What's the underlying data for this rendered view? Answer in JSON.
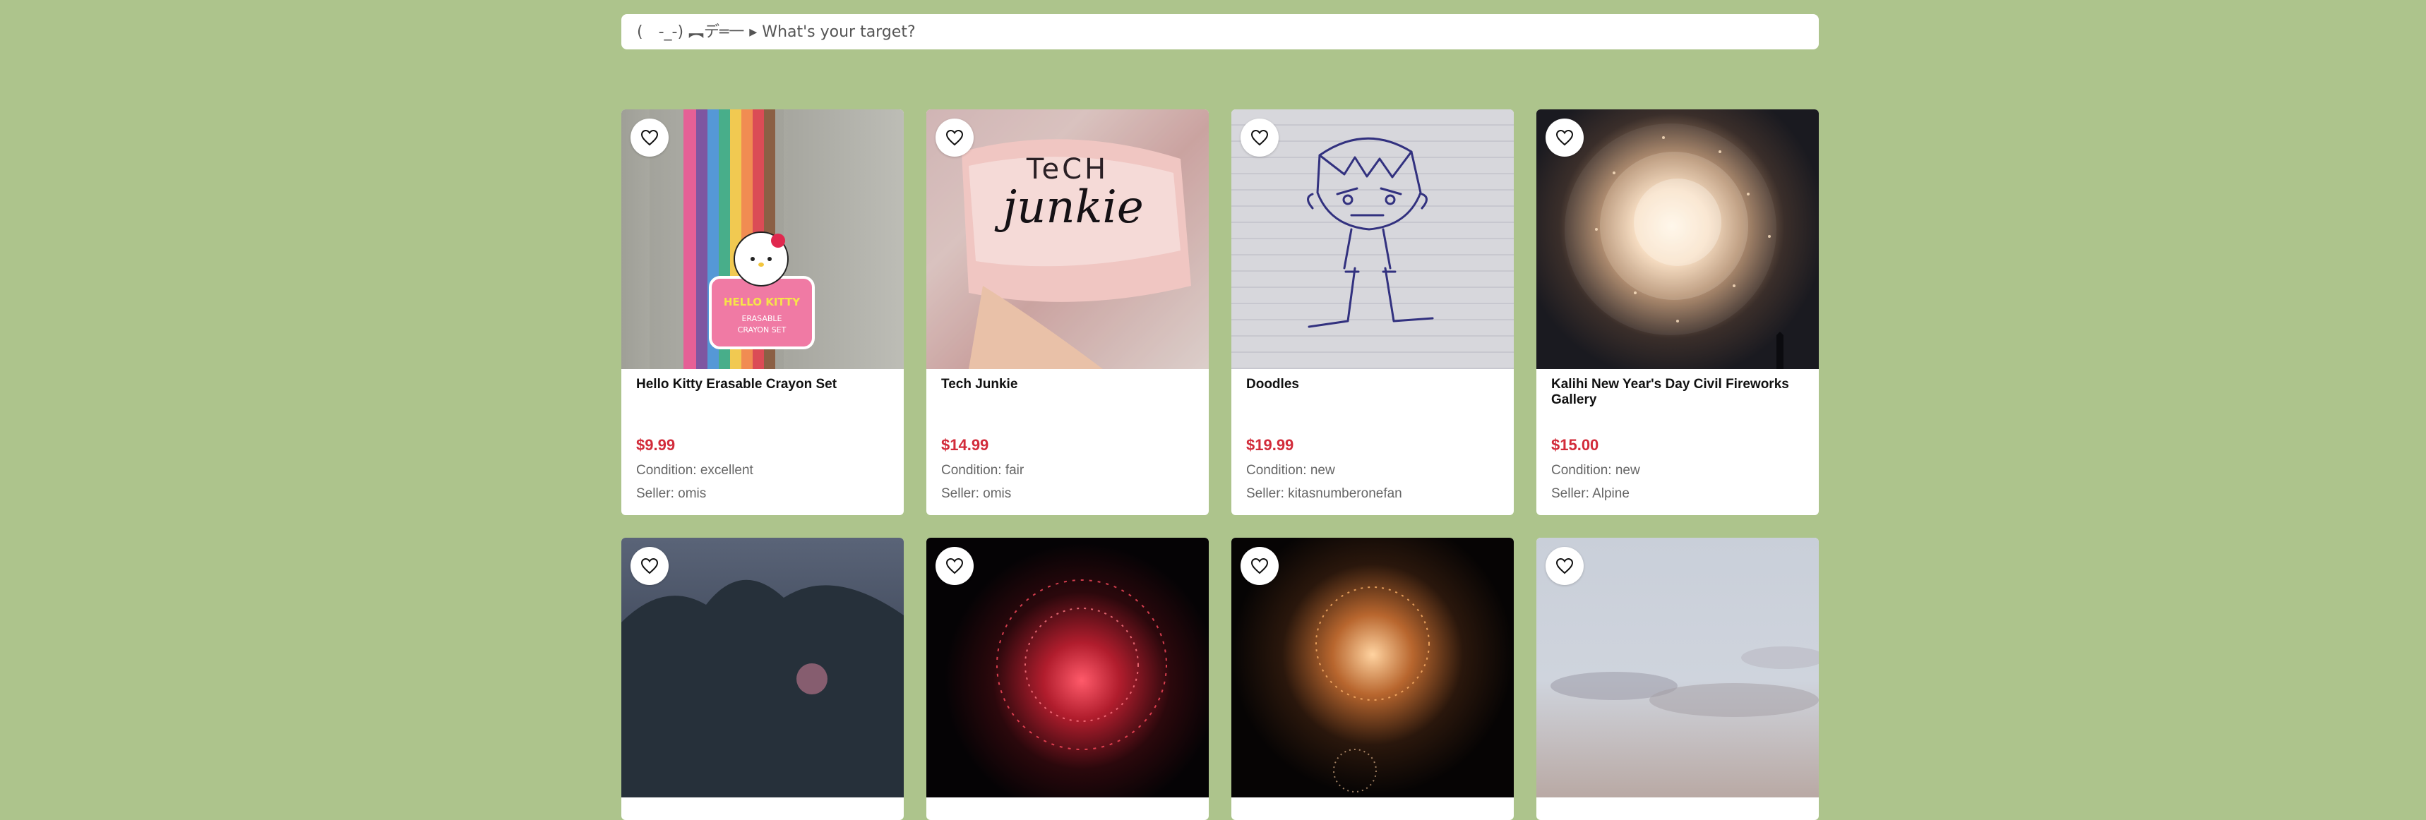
{
  "search": {
    "placeholder": "(　-_-) ︻デ═一 ▸ What's your target?"
  },
  "products": [
    {
      "title": "Hello Kitty Erasable Crayon Set",
      "price": "$9.99",
      "condition": "Condition: excellent",
      "seller": "Seller: omis",
      "image_text": "HELLO KITTY ERASABLE CRAYON SET"
    },
    {
      "title": "Tech Junkie",
      "price": "$14.99",
      "condition": "Condition: fair",
      "seller": "Seller: omis",
      "image_text": "TeCH Junkie"
    },
    {
      "title": "Doodles",
      "price": "$19.99",
      "condition": "Condition: new",
      "seller": "Seller: kitasnumberonefan"
    },
    {
      "title": "Kalihi New Year's Day Civil Fireworks Gallery",
      "price": "$15.00",
      "condition": "Condition: new",
      "seller": "Seller: Alpine"
    }
  ],
  "colors": {
    "background": "#adc48c",
    "price": "#d22b3a",
    "card": "#ffffff"
  },
  "icons": {
    "favorite": "heart-outline-icon"
  }
}
